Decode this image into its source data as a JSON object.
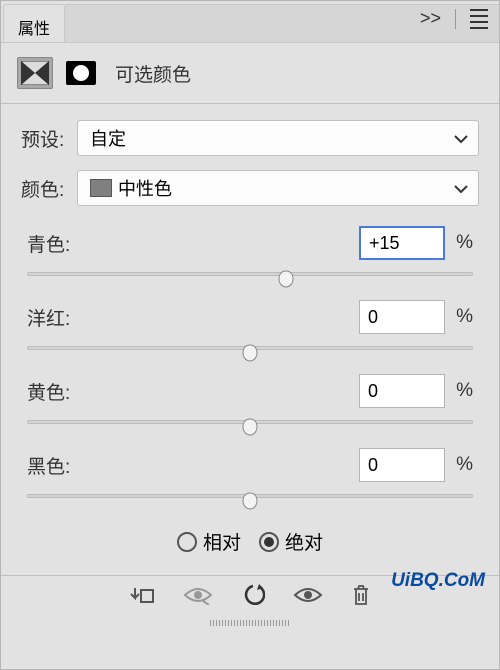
{
  "header": {
    "title_tab": "属性"
  },
  "adjustment": {
    "title": "可选颜色"
  },
  "preset": {
    "label": "预设:",
    "value": "自定"
  },
  "color": {
    "label": "颜色:",
    "value": "中性色",
    "swatch": "#808080"
  },
  "sliders": {
    "cyan": {
      "label": "青色:",
      "value": "+15",
      "percent": "%",
      "pos": 58,
      "focused": true
    },
    "magenta": {
      "label": "洋红:",
      "value": "0",
      "percent": "%",
      "pos": 50,
      "focused": false
    },
    "yellow": {
      "label": "黄色:",
      "value": "0",
      "percent": "%",
      "pos": 50,
      "focused": false
    },
    "black": {
      "label": "黑色:",
      "value": "0",
      "percent": "%",
      "pos": 50,
      "focused": false
    }
  },
  "method": {
    "relative": "相对",
    "absolute": "绝对",
    "selected": "absolute"
  },
  "footer": {
    "brand": "UiBQ.CoM"
  }
}
